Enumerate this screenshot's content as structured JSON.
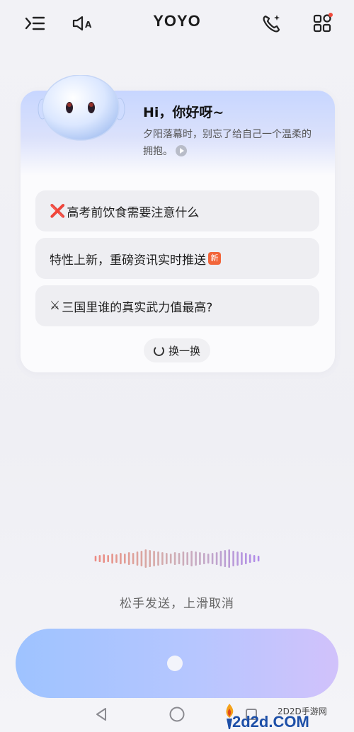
{
  "header": {
    "title": "YOYO"
  },
  "greeting": {
    "title": "Hi，你好呀~",
    "subtitle": "夕阳落幕时，别忘了给自己一个温柔的拥抱。"
  },
  "suggestions": [
    {
      "prefix": "❌",
      "text": "高考前饮食需要注意什么"
    },
    {
      "text": "特性上新，重磅资讯实时推送",
      "badge": "新"
    },
    {
      "prefix": "⚔",
      "text": "三国里谁的真实武力值最高?"
    }
  ],
  "refresh_label": "换一换",
  "voice": {
    "hint": "松手发送，上滑取消"
  },
  "watermark": {
    "top_text": "2D2D手游网",
    "main_text": "2d2d.COM"
  },
  "colors": {
    "accent_blue": "#9ec3ff",
    "accent_purple": "#d1c2fb",
    "badge_orange": "#f2653a"
  },
  "icons": {
    "menu": "menu-collapse-icon",
    "sound": "speaker-auto-icon",
    "call": "phone-sparkle-icon",
    "apps": "apps-grid-icon",
    "back": "back-triangle-icon",
    "home": "home-circle-icon",
    "recents": "recents-square-icon"
  }
}
